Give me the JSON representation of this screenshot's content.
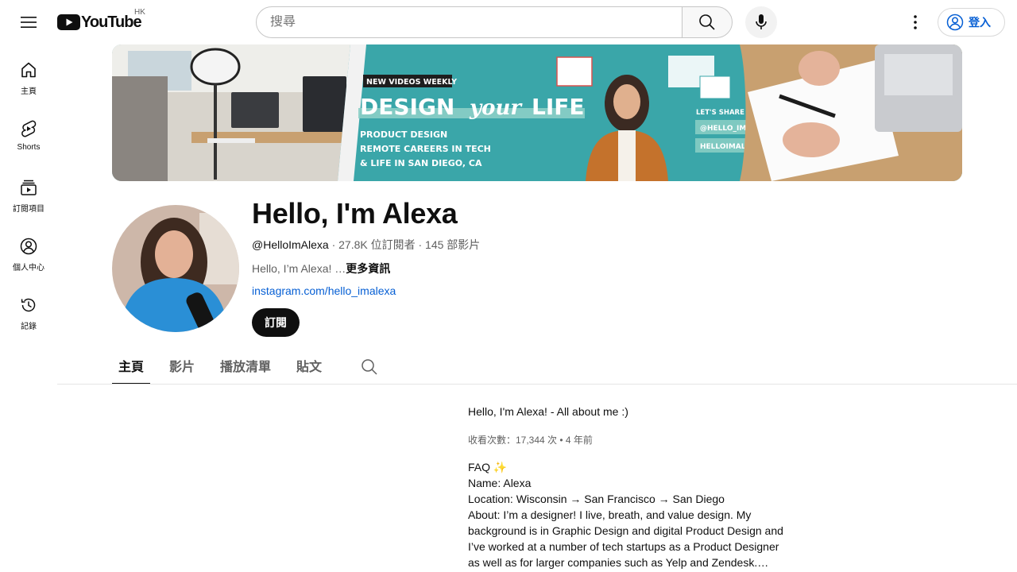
{
  "header": {
    "logo_text": "YouTube",
    "region": "HK",
    "search_placeholder": "搜尋",
    "signin_label": "登入"
  },
  "sidebar": {
    "items": [
      {
        "label": "主頁",
        "icon": "home-icon"
      },
      {
        "label": "Shorts",
        "icon": "shorts-icon"
      },
      {
        "label": "訂閱項目",
        "icon": "subscriptions-icon"
      },
      {
        "label": "個人中心",
        "icon": "you-icon"
      },
      {
        "label": "記錄",
        "icon": "history-icon"
      }
    ]
  },
  "banner": {
    "tag": "NEW VIDEOS WEEKLY",
    "headline_a": "DESIGN",
    "headline_b": "your",
    "headline_c": "LIFE",
    "line1": "PRODUCT DESIGN",
    "line2": "REMOTE CAREERS IN TECH",
    "line3": "& LIFE IN SAN DIEGO, CA",
    "stories": "LET'S SHARE STORIES",
    "instagram": "@HELLO_IMALEXA",
    "website": "HELLOIMALEXA.COM"
  },
  "channel": {
    "name": "Hello, I'm Alexa",
    "handle": "@HelloImAlexa",
    "stats": " · 27.8K 位訂閱者 · 145 部影片",
    "description": "Hello, I’m Alexa! …",
    "more_label": "更多資訊",
    "link": "instagram.com/hello_imalexa",
    "subscribe_label": "訂閱"
  },
  "tabs": [
    {
      "label": "主頁",
      "active": true
    },
    {
      "label": "影片",
      "active": false
    },
    {
      "label": "播放清單",
      "active": false
    },
    {
      "label": "貼文",
      "active": false
    }
  ],
  "featured": {
    "title": "Hello, I'm Alexa! - All about me :)",
    "meta": "收看次數：17,344 次 • 4 年前",
    "desc_lines": [
      "FAQ ✨",
      "Name: Alexa",
      "Location: Wisconsin → San Francisco → San Diego",
      "About: I’m a designer! I live, breath, and value design. My",
      "background is in Graphic Design and digital Product Design and",
      "I’ve worked at a number of tech startups as a Product Designer",
      "as well as for larger companies such as Yelp and Zendesk.…"
    ]
  },
  "colors": {
    "brand_red": "#ff0000",
    "link_blue": "#065fd4",
    "banner_teal": "#3aa6a9"
  }
}
